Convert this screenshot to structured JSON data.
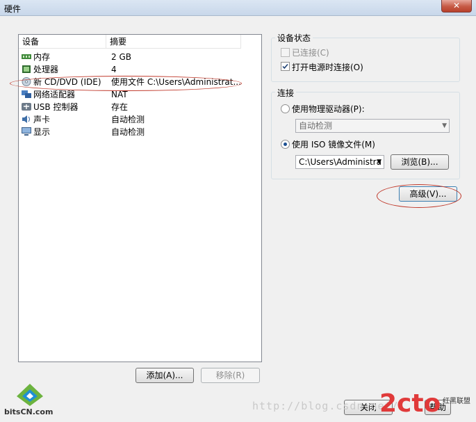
{
  "window": {
    "title": "硬件",
    "close_glyph": "✕"
  },
  "device_list": {
    "columns": [
      "设备",
      "摘要"
    ],
    "rows": [
      {
        "name": "内存",
        "summary": "2 GB",
        "icon": "memory-icon"
      },
      {
        "name": "处理器",
        "summary": "4",
        "icon": "processor-icon"
      },
      {
        "name": "新 CD/DVD (IDE)",
        "summary": "使用文件 C:\\Users\\Administrat...",
        "icon": "cd-dvd-icon"
      },
      {
        "name": "网络适配器",
        "summary": "NAT",
        "icon": "network-adapter-icon"
      },
      {
        "name": "USB 控制器",
        "summary": "存在",
        "icon": "usb-icon"
      },
      {
        "name": "声卡",
        "summary": "自动检测",
        "icon": "sound-card-icon"
      },
      {
        "name": "显示",
        "summary": "自动检测",
        "icon": "display-icon"
      }
    ],
    "add_button": "添加(A)...",
    "remove_button": "移除(R)"
  },
  "device_status": {
    "title": "设备状态",
    "connected": {
      "label": "已连接(C)",
      "checked": false,
      "enabled": false
    },
    "connect_at_power_on": {
      "label": "打开电源时连接(O)",
      "checked": true
    }
  },
  "connection": {
    "title": "连接",
    "physical": {
      "label": "使用物理驱动器(P):",
      "selected": false
    },
    "physical_combo": "自动检测",
    "iso": {
      "label": "使用 ISO 镜像文件(M)",
      "selected": true
    },
    "iso_path": "C:\\Users\\Administra",
    "browse_button": "浏览(B)..."
  },
  "advanced_button": "高级(V)...",
  "footer": {
    "close_button": "关闭",
    "help_button": "帮助",
    "watermark_url": "http://blog.csdn.net/",
    "logo_2cto": "2cto",
    "logo_bits": "bitsCN.com",
    "logo_hongke": "红黑联盟"
  }
}
